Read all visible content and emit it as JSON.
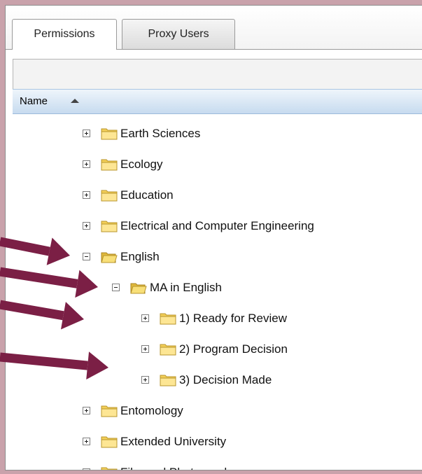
{
  "tabs": [
    {
      "label": "Permissions",
      "active": true
    },
    {
      "label": "Proxy Users",
      "active": false
    }
  ],
  "column": {
    "name_label": "Name"
  },
  "tree": [
    {
      "label": "Earth Sciences",
      "level": 0,
      "expanded": false
    },
    {
      "label": "Ecology",
      "level": 0,
      "expanded": false
    },
    {
      "label": "Education",
      "level": 0,
      "expanded": false
    },
    {
      "label": "Electrical and Computer Engineering",
      "level": 0,
      "expanded": false
    },
    {
      "label": "English",
      "level": 0,
      "expanded": true
    },
    {
      "label": "MA in English",
      "level": 1,
      "expanded": true
    },
    {
      "label": "1) Ready for Review",
      "level": 2,
      "expanded": false
    },
    {
      "label": "2) Program Decision",
      "level": 2,
      "expanded": false
    },
    {
      "label": "3) Decision Made",
      "level": 2,
      "expanded": false
    },
    {
      "label": "Entomology",
      "level": 0,
      "expanded": false
    },
    {
      "label": "Extended University",
      "level": 0,
      "expanded": false
    },
    {
      "label": "Film and Photography",
      "level": 0,
      "expanded": false
    }
  ],
  "colors": {
    "annotation_arrow": "#7b1f45",
    "background": "#c9a2ab",
    "header": "#c7dbef"
  }
}
